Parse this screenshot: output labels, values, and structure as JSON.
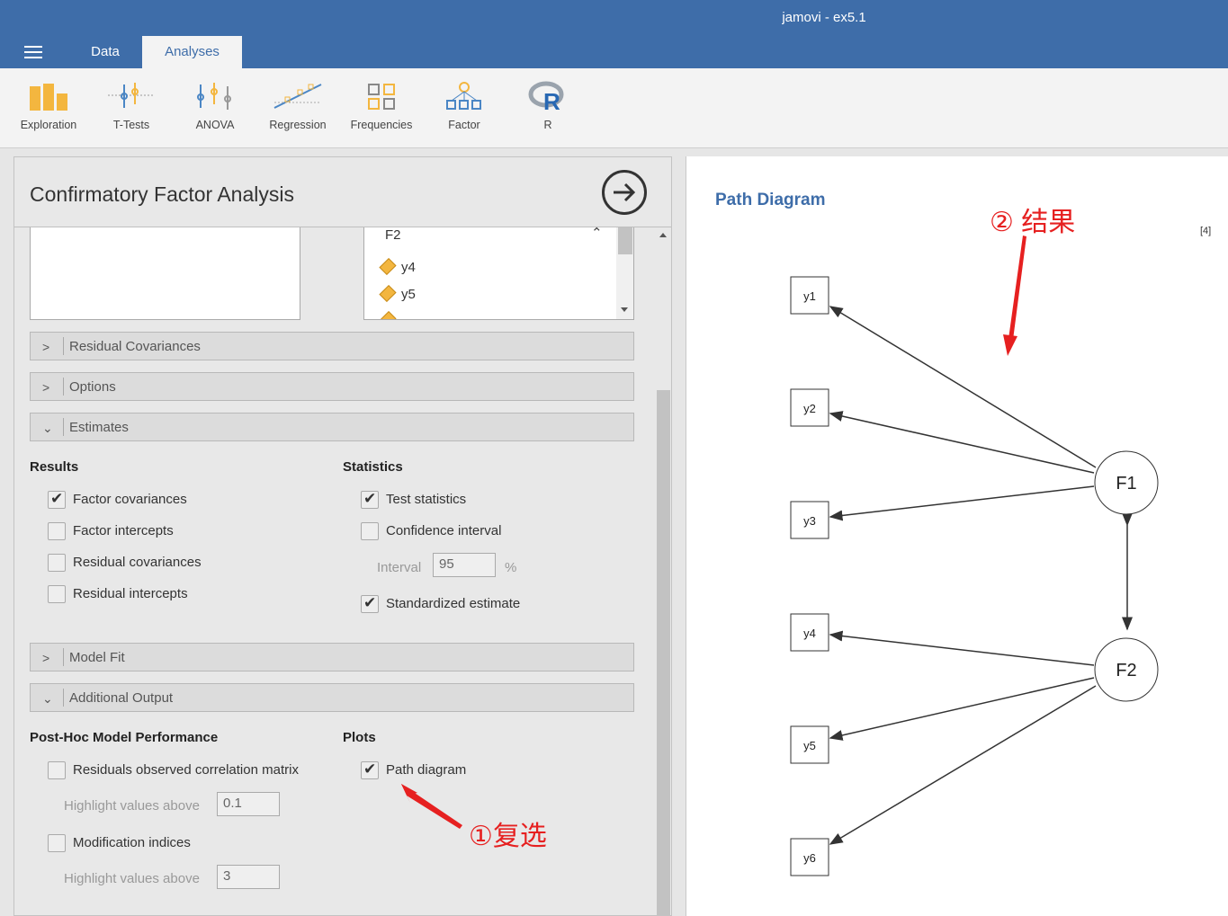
{
  "app": {
    "title": "jamovi - ex5.1"
  },
  "tabs": {
    "data": "Data",
    "analyses": "Analyses"
  },
  "ribbon": {
    "items": [
      {
        "label": "Exploration",
        "icon": "exploration-icon"
      },
      {
        "label": "T-Tests",
        "icon": "t-tests-icon"
      },
      {
        "label": "ANOVA",
        "icon": "anova-icon"
      },
      {
        "label": "Regression",
        "icon": "regression-icon"
      },
      {
        "label": "Frequencies",
        "icon": "frequencies-icon"
      },
      {
        "label": "Factor",
        "icon": "factor-icon"
      },
      {
        "label": "R",
        "icon": "r-icon"
      }
    ]
  },
  "panel": {
    "title": "Confirmatory Factor Analysis",
    "factor_box": {
      "name": "F2",
      "vars": [
        "y4",
        "y5"
      ]
    },
    "sections": {
      "residual_covariances": "Residual Covariances",
      "options": "Options",
      "estimates": "Estimates",
      "model_fit": "Model Fit",
      "additional_output": "Additional Output"
    },
    "estimates": {
      "results_title": "Results",
      "statistics_title": "Statistics",
      "factor_covariances": "Factor covariances",
      "factor_intercepts": "Factor intercepts",
      "residual_covariances": "Residual covariances",
      "residual_intercepts": "Residual intercepts",
      "test_statistics": "Test statistics",
      "confidence_interval": "Confidence interval",
      "interval_label": "Interval",
      "interval_value": "95",
      "interval_unit": "%",
      "standardized_estimate": "Standardized estimate"
    },
    "additional": {
      "posthoc_title": "Post-Hoc Model Performance",
      "plots_title": "Plots",
      "residuals_matrix": "Residuals observed correlation matrix",
      "highlight_label_1": "Highlight values above",
      "highlight_value_1": "0.1",
      "modification_indices": "Modification indices",
      "highlight_label_2": "Highlight values above",
      "highlight_value_2": "3",
      "path_diagram": "Path diagram"
    }
  },
  "annotations": {
    "left": "①复选",
    "right": "② 结果",
    "color": "#e62020"
  },
  "results": {
    "title": "Path Diagram",
    "ref": "[4]",
    "diagram": {
      "latent": [
        "F1",
        "F2"
      ],
      "observed": [
        "y1",
        "y2",
        "y3",
        "y4",
        "y5",
        "y6"
      ]
    }
  },
  "colors": {
    "brand": "#3e6da9",
    "ribbon_icon": "#f3b63f"
  }
}
